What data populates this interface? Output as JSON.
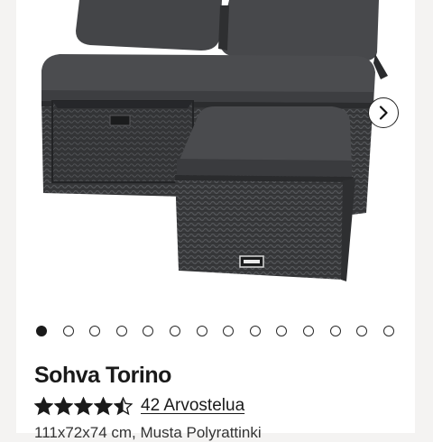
{
  "gallery": {
    "image_alt": "Sohva Torino",
    "slide_count": 14,
    "active_index": 0,
    "next_icon": "chevron-right-icon"
  },
  "product": {
    "title": "Sohva Torino",
    "rating": 4.5,
    "rating_max": 5,
    "reviews_label": "42 Arvostelua",
    "details": "111x72x74 cm, Musta Polyrattinki"
  },
  "colors": {
    "rattan": "#3a3b3d",
    "cushion": "#48494c",
    "text": "#1a1a1a"
  }
}
